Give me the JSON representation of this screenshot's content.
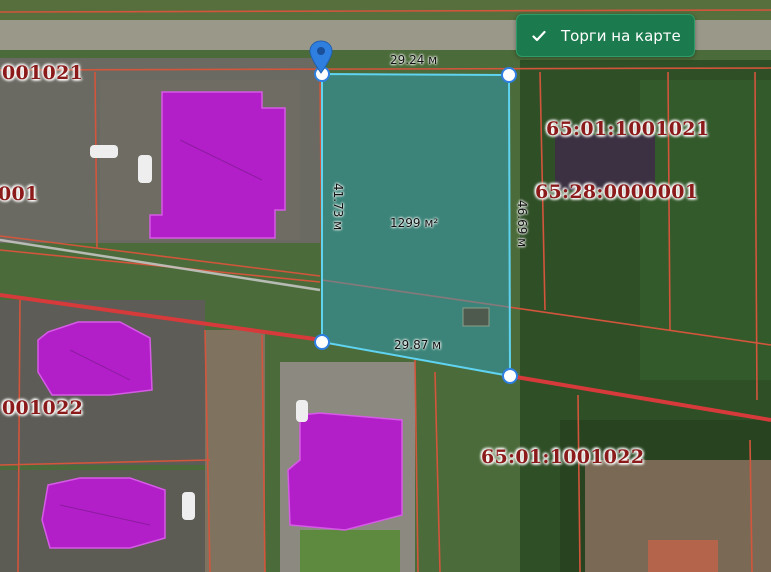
{
  "map": {
    "colors": {
      "parcel_border": "#d2553c",
      "road_line": "#d73a3a",
      "selection_fill": "#2aa3c8",
      "selection_stroke": "#5fd3f0",
      "roof": "#b21fc9",
      "vertex": "#2f7fe0"
    },
    "cadastral_labels": {
      "top_left": "001021",
      "left": "001",
      "right_upper": "65:01:1001021",
      "right_mid": "65:28:0000001",
      "left_lower": "001022",
      "bottom": "65:01:1001022"
    },
    "selection": {
      "top_edge": "29.24 м",
      "left_edge": "41.73 м",
      "right_edge": "46.69 м",
      "bottom_edge": "29.87 м",
      "area": "1299 м²"
    }
  },
  "auction_button": {
    "label": "Торги на карте",
    "icon": "check-icon"
  },
  "pin": {
    "icon": "map-pin-icon"
  }
}
